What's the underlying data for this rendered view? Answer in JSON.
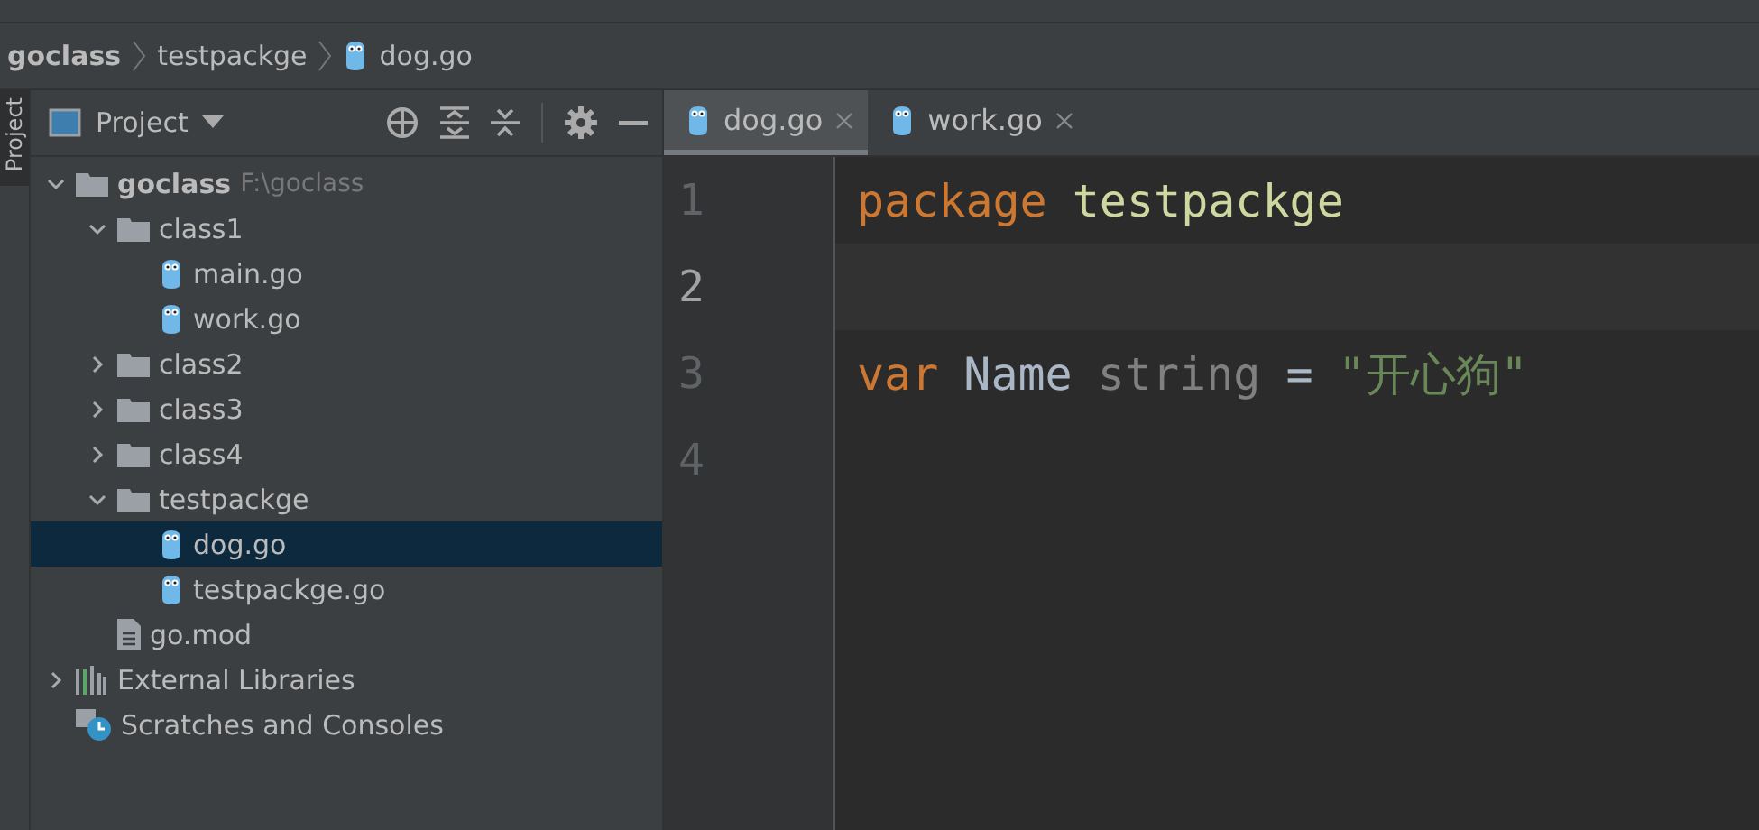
{
  "breadcrumb": [
    {
      "label": "goclass",
      "kind": "project"
    },
    {
      "label": "testpackge",
      "kind": "folder"
    },
    {
      "label": "dog.go",
      "kind": "gofile"
    }
  ],
  "side_tab": {
    "label": "Project",
    "selected": true
  },
  "project_panel": {
    "title": "Project"
  },
  "tree": [
    {
      "label": "goclass",
      "path": "F:\\goclass",
      "kind": "folder",
      "expanded": true,
      "selected": false,
      "children": [
        {
          "label": "class1",
          "kind": "folder",
          "expanded": true,
          "selected": false,
          "children": [
            {
              "label": "main.go",
              "kind": "gofile",
              "selected": false
            },
            {
              "label": "work.go",
              "kind": "gofile",
              "selected": false
            }
          ]
        },
        {
          "label": "class2",
          "kind": "folder",
          "expanded": false,
          "selected": false
        },
        {
          "label": "class3",
          "kind": "folder",
          "expanded": false,
          "selected": false
        },
        {
          "label": "class4",
          "kind": "folder",
          "expanded": false,
          "selected": false
        },
        {
          "label": "testpackge",
          "kind": "folder",
          "expanded": true,
          "selected": false,
          "children": [
            {
              "label": "dog.go",
              "kind": "gofile",
              "selected": true
            },
            {
              "label": "testpackge.go",
              "kind": "gofile",
              "selected": false
            }
          ]
        },
        {
          "label": "go.mod",
          "kind": "modfile",
          "selected": false
        }
      ]
    },
    {
      "label": "External Libraries",
      "kind": "libraries",
      "expanded": false,
      "selected": false
    },
    {
      "label": "Scratches and Consoles",
      "kind": "scratches",
      "selected": false
    }
  ],
  "tabs": [
    {
      "label": "dog.go",
      "selected": true
    },
    {
      "label": "work.go",
      "selected": false
    }
  ],
  "code_lines": [
    {
      "number": "1",
      "current": false,
      "tokens": [
        {
          "text": "package",
          "kind": "keyword"
        },
        {
          "text": "testpackge",
          "kind": "package"
        }
      ]
    },
    {
      "number": "2",
      "current": true
    },
    {
      "number": "3",
      "current": false,
      "tokens": [
        {
          "text": "var",
          "kind": "keyword"
        },
        {
          "text": "Name",
          "kind": "identifier"
        },
        {
          "text": "string",
          "kind": "type"
        },
        {
          "text": "=",
          "kind": "operator"
        },
        {
          "text": "\"开心狗\"",
          "kind": "string"
        }
      ]
    },
    {
      "number": "4",
      "current": false
    }
  ]
}
